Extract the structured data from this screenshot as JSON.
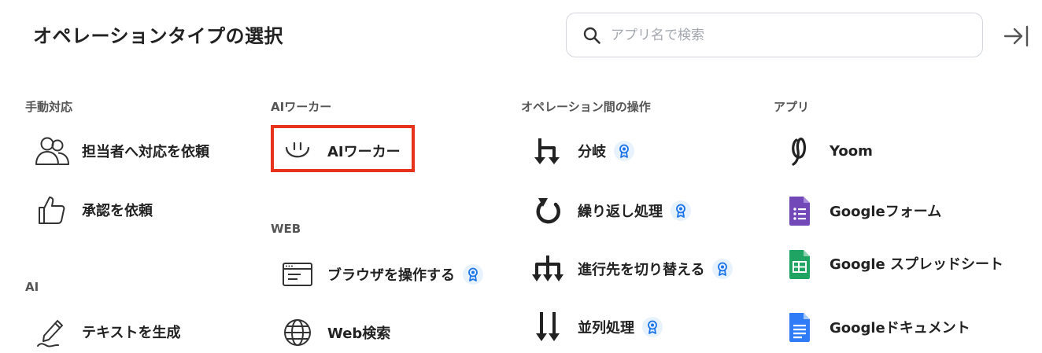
{
  "header": {
    "title": "オペレーションタイプの選択",
    "search_placeholder": "アプリ名で検索"
  },
  "icons": {
    "search": "search-icon",
    "collapse": "collapse-panel-icon",
    "premium_badge": "premium-badge-icon"
  },
  "colors": {
    "selection_border": "#e8331c",
    "badge_background": "#e8f2fd",
    "badge_icon": "#1a73e8"
  },
  "columns": {
    "manual": {
      "heading": "手動対応",
      "items": [
        {
          "label": "担当者へ対応を依頼",
          "icon": "people-icon"
        },
        {
          "label": "承認を依頼",
          "icon": "thumbs-up-icon"
        }
      ]
    },
    "ai": {
      "heading": "AI",
      "items": [
        {
          "label": "テキストを生成",
          "icon": "pen-icon"
        }
      ]
    },
    "ai_worker": {
      "heading": "AIワーカー",
      "items": [
        {
          "label": "AIワーカー",
          "icon": "ai-worker-face-icon",
          "selected": true
        }
      ]
    },
    "web": {
      "heading": "WEB",
      "items": [
        {
          "label": "ブラウザを操作する",
          "icon": "browser-window-icon",
          "premium": true
        },
        {
          "label": "Web検索",
          "icon": "globe-icon"
        }
      ]
    },
    "operations": {
      "heading": "オペレーション間の操作",
      "items": [
        {
          "label": "分岐",
          "icon": "branch-icon",
          "premium": true
        },
        {
          "label": "繰り返し処理",
          "icon": "loop-icon",
          "premium": true
        },
        {
          "label": "進行先を切り替える",
          "icon": "switch-route-icon",
          "premium": true
        },
        {
          "label": "並列処理",
          "icon": "parallel-icon",
          "premium": true
        }
      ]
    },
    "apps": {
      "heading": "アプリ",
      "items": [
        {
          "label": "Yoom",
          "icon": "yoom-logo-icon"
        },
        {
          "label": "Googleフォーム",
          "icon": "google-forms-icon"
        },
        {
          "label": "Google スプレッドシート",
          "icon": "google-sheets-icon"
        },
        {
          "label": "Googleドキュメント",
          "icon": "google-docs-icon"
        }
      ]
    }
  }
}
